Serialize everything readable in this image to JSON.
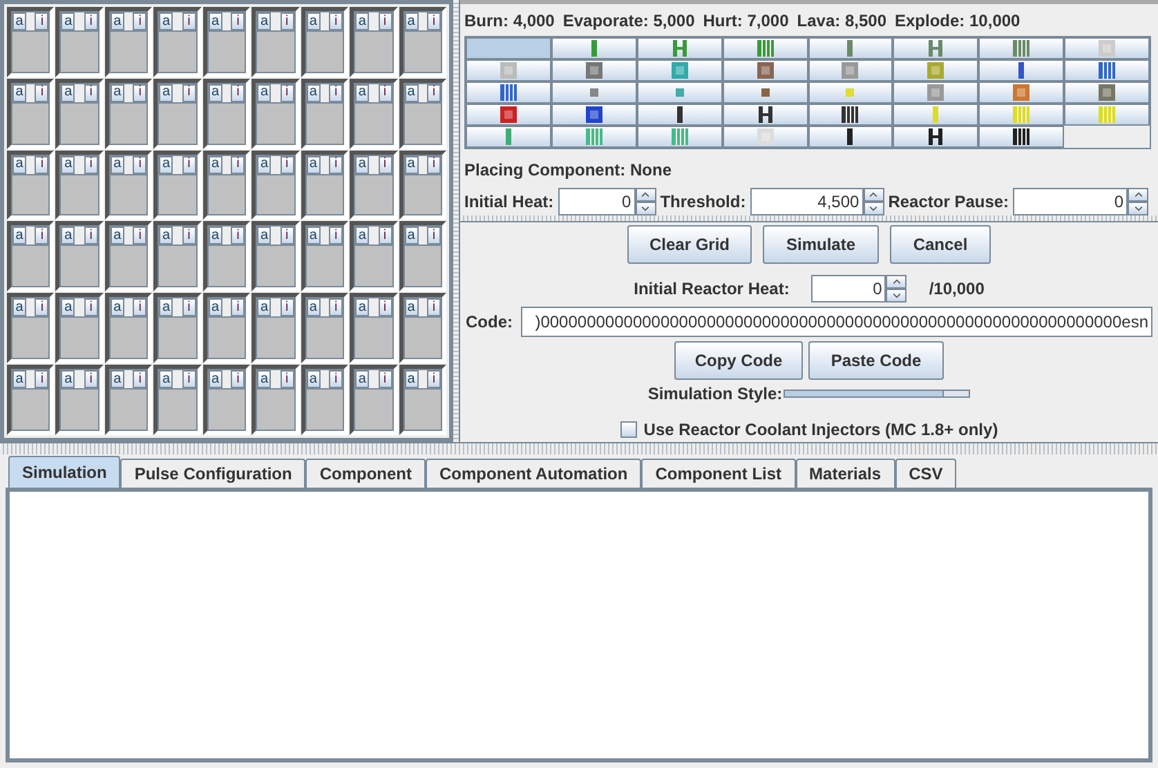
{
  "grid": [
    [
      {
        "a": "a",
        "i": "i"
      },
      {
        "a": "a",
        "i": "i"
      },
      {
        "a": "a",
        "i": "i"
      },
      {
        "a": "a",
        "i": "i"
      },
      {
        "a": "a",
        "i": "i"
      },
      {
        "a": "a",
        "i": "i"
      },
      {
        "a": "a",
        "i": "i"
      },
      {
        "a": "a",
        "i": "i"
      },
      {
        "a": "a",
        "i": "i"
      }
    ],
    [
      {
        "a": "a",
        "i": "i"
      },
      {
        "a": "a",
        "i": "i"
      },
      {
        "a": "a",
        "i": "i"
      },
      {
        "a": "a",
        "i": "i"
      },
      {
        "a": "a",
        "i": "i"
      },
      {
        "a": "a",
        "i": "i"
      },
      {
        "a": "a",
        "i": "i"
      },
      {
        "a": "a",
        "i": "i"
      },
      {
        "a": "a",
        "i": "i"
      }
    ],
    [
      {
        "a": "a",
        "i": "i"
      },
      {
        "a": "a",
        "i": "i"
      },
      {
        "a": "a",
        "i": "i"
      },
      {
        "a": "a",
        "i": "i"
      },
      {
        "a": "a",
        "i": "i"
      },
      {
        "a": "a",
        "i": "i"
      },
      {
        "a": "a",
        "i": "i"
      },
      {
        "a": "a",
        "i": "i"
      },
      {
        "a": "a",
        "i": "i"
      }
    ],
    [
      {
        "a": "a",
        "i": "i"
      },
      {
        "a": "a",
        "i": "i"
      },
      {
        "a": "a",
        "i": "i"
      },
      {
        "a": "a",
        "i": "i"
      },
      {
        "a": "a",
        "i": "i"
      },
      {
        "a": "a",
        "i": "i"
      },
      {
        "a": "a",
        "i": "i"
      },
      {
        "a": "a",
        "i": "i"
      },
      {
        "a": "a",
        "i": "i"
      }
    ],
    [
      {
        "a": "a",
        "i": "i"
      },
      {
        "a": "a",
        "i": "i"
      },
      {
        "a": "a",
        "i": "i"
      },
      {
        "a": "a",
        "i": "i"
      },
      {
        "a": "a",
        "i": "i"
      },
      {
        "a": "a",
        "i": "i"
      },
      {
        "a": "a",
        "i": "i"
      },
      {
        "a": "a",
        "i": "i"
      },
      {
        "a": "a",
        "i": "i"
      }
    ],
    [
      {
        "a": "a",
        "i": "i"
      },
      {
        "a": "a",
        "i": "i"
      },
      {
        "a": "a",
        "i": "i"
      },
      {
        "a": "a",
        "i": "i"
      },
      {
        "a": "a",
        "i": "i"
      },
      {
        "a": "a",
        "i": "i"
      },
      {
        "a": "a",
        "i": "i"
      },
      {
        "a": "a",
        "i": "i"
      },
      {
        "a": "a",
        "i": "i"
      }
    ]
  ],
  "heat_thresholds": [
    "Burn: 4,000",
    "Evaporate: 5,000",
    "Hurt: 7,000",
    "Lava: 8,500",
    "Explode: 10,000"
  ],
  "palette": [
    {
      "selected": true
    },
    {
      "selected": false
    },
    {
      "selected": false
    },
    {
      "selected": false
    },
    {
      "selected": false
    },
    {
      "selected": false
    },
    {
      "selected": false
    },
    {
      "selected": false
    },
    {
      "selected": false
    },
    {
      "selected": false
    },
    {
      "selected": false
    },
    {
      "selected": false
    },
    {
      "selected": false
    },
    {
      "selected": false
    },
    {
      "selected": false
    },
    {
      "selected": false
    },
    {
      "selected": false
    },
    {
      "selected": false
    },
    {
      "selected": false
    },
    {
      "selected": false
    },
    {
      "selected": false
    },
    {
      "selected": false
    },
    {
      "selected": false
    },
    {
      "selected": false
    },
    {
      "selected": false
    },
    {
      "selected": false
    },
    {
      "selected": false
    },
    {
      "selected": false
    },
    {
      "selected": false
    },
    {
      "selected": false
    },
    {
      "selected": false
    },
    {
      "selected": false
    },
    {
      "selected": false
    },
    {
      "selected": false
    },
    {
      "selected": false
    },
    {
      "selected": false
    },
    {
      "selected": false
    },
    {
      "selected": false
    },
    {
      "selected": false
    }
  ],
  "placing_component": "Placing Component: None",
  "spinners": [
    {
      "label": "Initial Heat:",
      "value": "0"
    },
    {
      "label": "Threshold:",
      "value": "4,500"
    },
    {
      "label": "Reactor Pause:",
      "value": "0"
    }
  ],
  "actions": [
    "Clear Grid",
    "Simulate",
    "Cancel"
  ],
  "initial_reactor_heat": {
    "label": "Initial Reactor Heat:",
    "value": "0",
    "max": "/10,000"
  },
  "code": {
    "label": "Code:",
    "value": ")000000000000000000000000000000000000000000000000000000000000000esn"
  },
  "code_buttons": [
    "Copy Code",
    "Paste Code"
  ],
  "simulation_style": {
    "label": "Simulation Style:",
    "level": 0.86
  },
  "coolant_injectors": {
    "label": "Use Reactor Coolant Injectors (MC 1.8+ only)",
    "checked": false
  },
  "tabs": [
    {
      "label": "Simulation",
      "selected": true
    },
    {
      "label": "Pulse Configuration",
      "selected": false
    },
    {
      "label": "Component",
      "selected": false
    },
    {
      "label": "Component Automation",
      "selected": false
    },
    {
      "label": "Component List",
      "selected": false
    },
    {
      "label": "Materials",
      "selected": false
    },
    {
      "label": "CSV",
      "selected": false
    }
  ]
}
